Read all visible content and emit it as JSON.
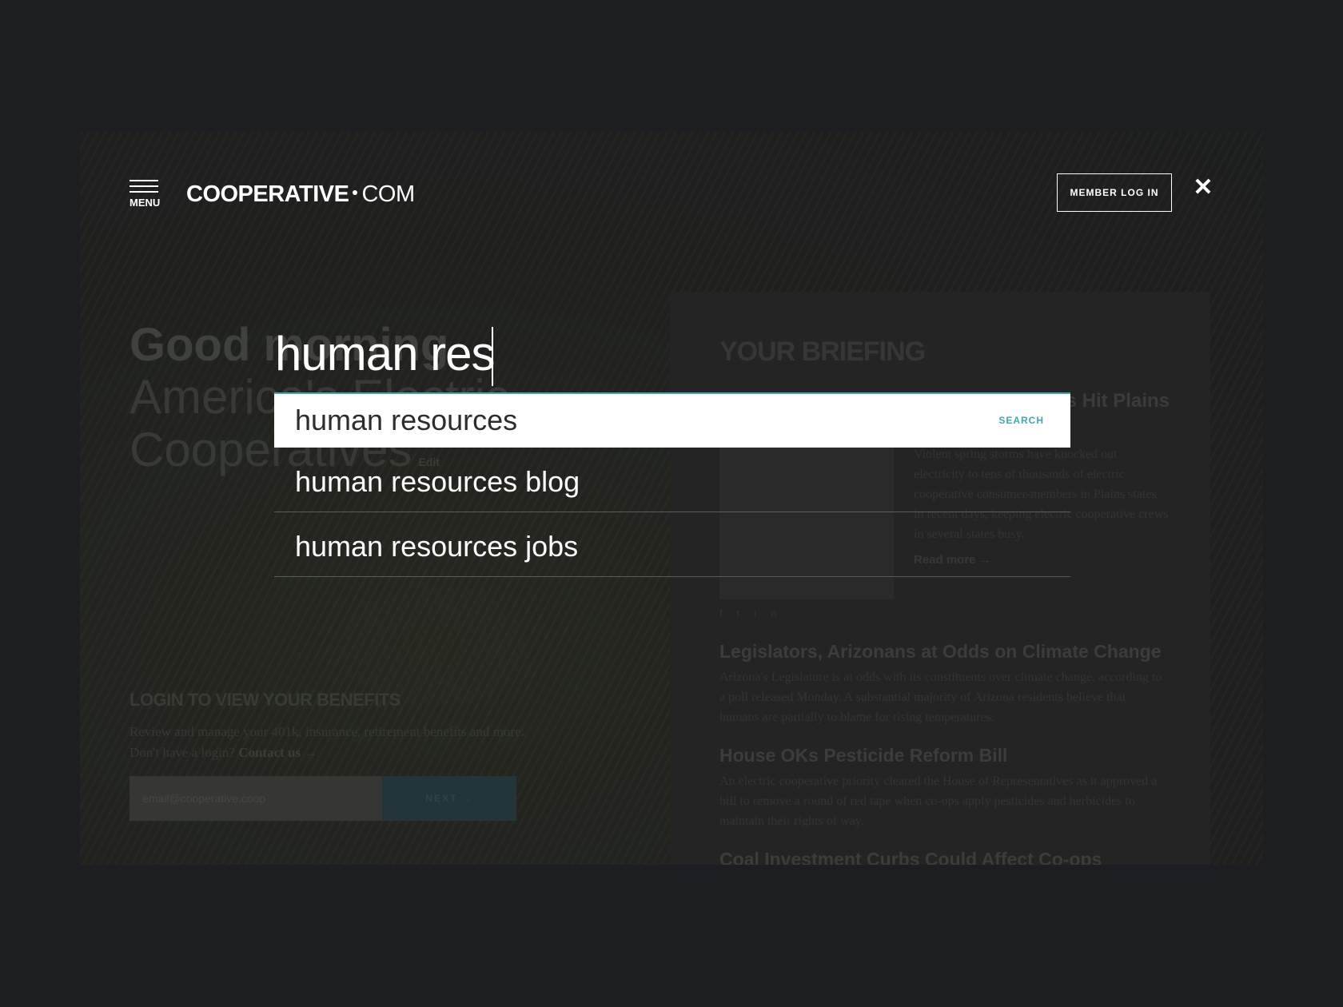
{
  "header": {
    "menu_label": "MENU",
    "logo_bold": "COOPERATIVE",
    "logo_light": "COM",
    "member_login": "MEMBER LOG IN",
    "close_glyph": "✕"
  },
  "search": {
    "query": "human res",
    "action_label": "SEARCH",
    "accent_color": "#3fa7b3",
    "suggestions": [
      "human resources",
      "human resources blog",
      "human resources jobs"
    ]
  },
  "background": {
    "greeting_line1": "Good morning",
    "greeting_line2": "America's Electric",
    "greeting_line3": "Cooperatives",
    "edit_label": "Edit",
    "login_title": "LOGIN TO VIEW YOUR BENEFITS",
    "login_text": "Review and manage your 401k, insurance, retirement benefits and more.",
    "login_prompt": "Don't have a login?",
    "contact_link": "Contact us →",
    "email_placeholder": "email@cooperative.coop",
    "next_label": "NEXT →",
    "briefing_title": "YOUR BRIEFING",
    "feature": {
      "title": "Storms Hit Plains",
      "text": "Violent spring storms have knocked out electricity to tens of thousands of electric cooperative consumer-members in Plains states in recent days, keeping electric cooperative crews in several states busy.",
      "read_more": "Read more →"
    },
    "stories": [
      {
        "title": "Legislators, Arizonans at Odds on Climate Change",
        "text": "Arizona's Legislature is at odds with its constituents over climate change, according to a poll released Monday. A substantial majority of Arizona residents believe that humans are partially to blame for rising temperatures."
      },
      {
        "title": "House OKs Pesticide Reform Bill",
        "text": "An electric cooperative priority cleared the House of Representatives as it approved a bill to remove a round of red tape when co-ops apply pesticides and herbicides to maintain their rights of way."
      },
      {
        "title": "Coal Investment Curbs Could Affect Co-ops",
        "text": ""
      }
    ]
  }
}
